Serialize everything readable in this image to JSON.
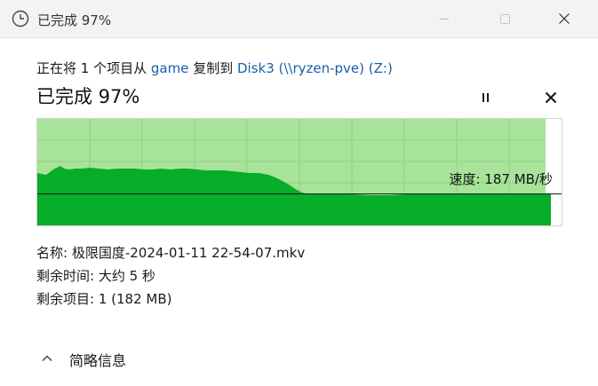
{
  "window": {
    "title": "已完成 97%",
    "icon": "clock-icon"
  },
  "copy_line": {
    "prefix": "正在将 1 个项目从 ",
    "source": "game",
    "middle": " 复制到 ",
    "destination": "Disk3 (\\\\ryzen-pve) (Z:)"
  },
  "status": {
    "text": "已完成 97%",
    "progress_percent": 97
  },
  "chart": {
    "speed_label": "速度: 187 MB/秒",
    "colors": {
      "fill": "#06ad29",
      "background": "#a8e39a",
      "grid": "#92cf86",
      "speed_line": "#1a1a1a"
    }
  },
  "details": {
    "name": "名称: 极限国度-2024-01-11 22-54-07.mkv",
    "time_remaining": "剩余时间: 大约 5 秒",
    "items_remaining": "剩余项目: 1 (182 MB)"
  },
  "footer": {
    "toggle_label": "简略信息",
    "toggle_icon": "chevron-up-icon"
  }
}
